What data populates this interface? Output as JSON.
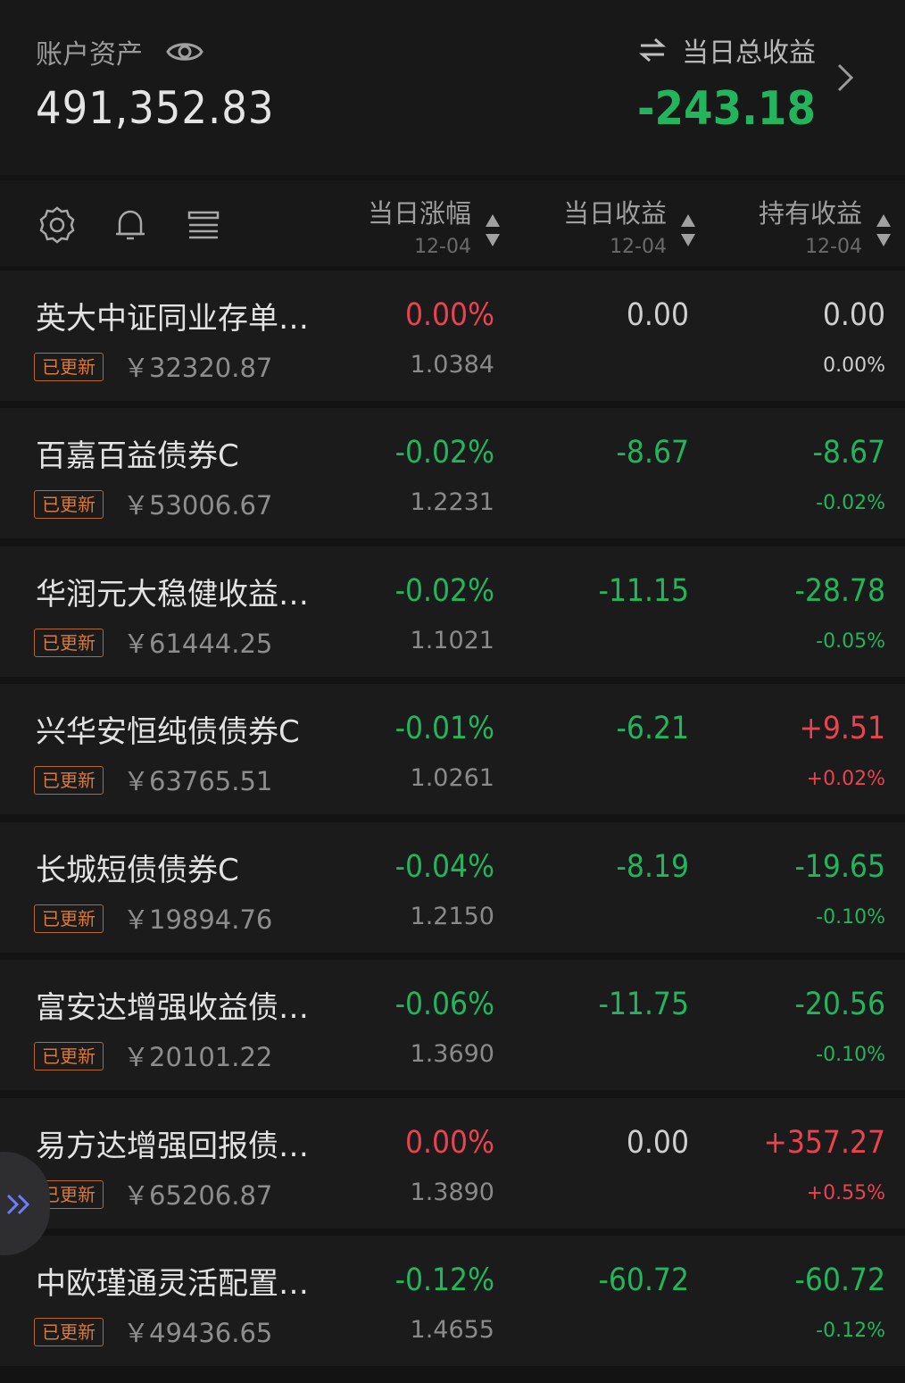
{
  "header": {
    "account_label": "账户资产",
    "account_value": "491,352.83",
    "day_label": "当日总收益",
    "day_value": "-243.18"
  },
  "columns": [
    {
      "title": "当日涨幅",
      "date": "12-04"
    },
    {
      "title": "当日收益",
      "date": "12-04"
    },
    {
      "title": "持有收益",
      "date": "12-04"
    }
  ],
  "badge_label": "已更新",
  "funds": [
    {
      "name": "英大中证同业存单…",
      "amount": "￥32320.87",
      "change_pct": "0.00%",
      "nav": "1.0384",
      "day_profit": "0.00",
      "hold_profit": "0.00",
      "hold_pct": "0.00%",
      "c1": "red",
      "c2": "neutral",
      "c3": "neutral"
    },
    {
      "name": "百嘉百益债券C",
      "amount": "￥53006.67",
      "change_pct": "-0.02%",
      "nav": "1.2231",
      "day_profit": "-8.67",
      "hold_profit": "-8.67",
      "hold_pct": "-0.02%",
      "c1": "green",
      "c2": "green",
      "c3": "green"
    },
    {
      "name": "华润元大稳健收益…",
      "amount": "￥61444.25",
      "change_pct": "-0.02%",
      "nav": "1.1021",
      "day_profit": "-11.15",
      "hold_profit": "-28.78",
      "hold_pct": "-0.05%",
      "c1": "green",
      "c2": "green",
      "c3": "green"
    },
    {
      "name": "兴华安恒纯债债券C",
      "amount": "￥63765.51",
      "change_pct": "-0.01%",
      "nav": "1.0261",
      "day_profit": "-6.21",
      "hold_profit": "+9.51",
      "hold_pct": "+0.02%",
      "c1": "green",
      "c2": "green",
      "c3": "red"
    },
    {
      "name": "长城短债债券C",
      "amount": "￥19894.76",
      "change_pct": "-0.04%",
      "nav": "1.2150",
      "day_profit": "-8.19",
      "hold_profit": "-19.65",
      "hold_pct": "-0.10%",
      "c1": "green",
      "c2": "green",
      "c3": "green"
    },
    {
      "name": "富安达增强收益债…",
      "amount": "￥20101.22",
      "change_pct": "-0.06%",
      "nav": "1.3690",
      "day_profit": "-11.75",
      "hold_profit": "-20.56",
      "hold_pct": "-0.10%",
      "c1": "green",
      "c2": "green",
      "c3": "green"
    },
    {
      "name": "易方达增强回报债…",
      "amount": "￥65206.87",
      "change_pct": "0.00%",
      "nav": "1.3890",
      "day_profit": "0.00",
      "hold_profit": "+357.27",
      "hold_pct": "+0.55%",
      "c1": "red",
      "c2": "neutral",
      "c3": "red"
    },
    {
      "name": "中欧瑾通灵活配置…",
      "amount": "￥49436.65",
      "change_pct": "-0.12%",
      "nav": "1.4655",
      "day_profit": "-60.72",
      "hold_profit": "-60.72",
      "hold_pct": "-0.12%",
      "c1": "green",
      "c2": "green",
      "c3": "green"
    }
  ],
  "icons": [
    "eye-icon",
    "swap-icon",
    "chevron-right-icon",
    "settings-icon",
    "bell-icon",
    "list-icon",
    "sort-icon",
    "expand-icon"
  ]
}
